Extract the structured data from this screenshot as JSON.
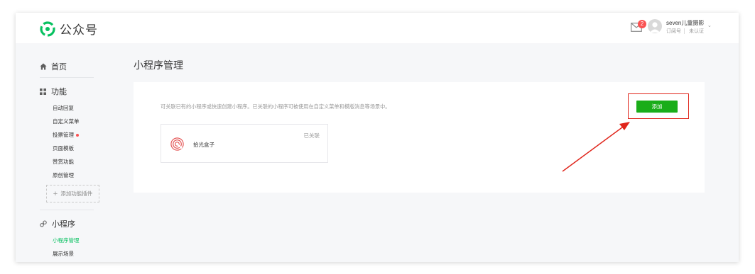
{
  "app": {
    "logo_text": "公众号",
    "brand_color": "#07c160"
  },
  "header": {
    "mail_badge": "2",
    "account_name": "seven儿童摄影",
    "account_type": "订阅号",
    "account_status": "未认证",
    "caret": "⌄"
  },
  "sidebar": {
    "home_label": "首页",
    "features_label": "功能",
    "feature_items": [
      "自动回复",
      "自定义菜单",
      "投票管理",
      "页面模板",
      "赞赏功能",
      "原创管理"
    ],
    "add_plugin_label": "添加功能插件",
    "miniprogram_label": "小程序",
    "miniprogram_items": [
      "小程序管理",
      "展示场景"
    ]
  },
  "main": {
    "page_title": "小程序管理",
    "description": "可关联已有的小程序或快速创建小程序。已关联的小程序可被使用在自定义菜单和模版消息等场景中。",
    "add_button": "添加",
    "miniprogram": {
      "name": "拾光盒子",
      "status": "已关联"
    }
  },
  "colors": {
    "highlight": "#e0251b",
    "button": "#1aad19",
    "badge": "#fa5151"
  }
}
